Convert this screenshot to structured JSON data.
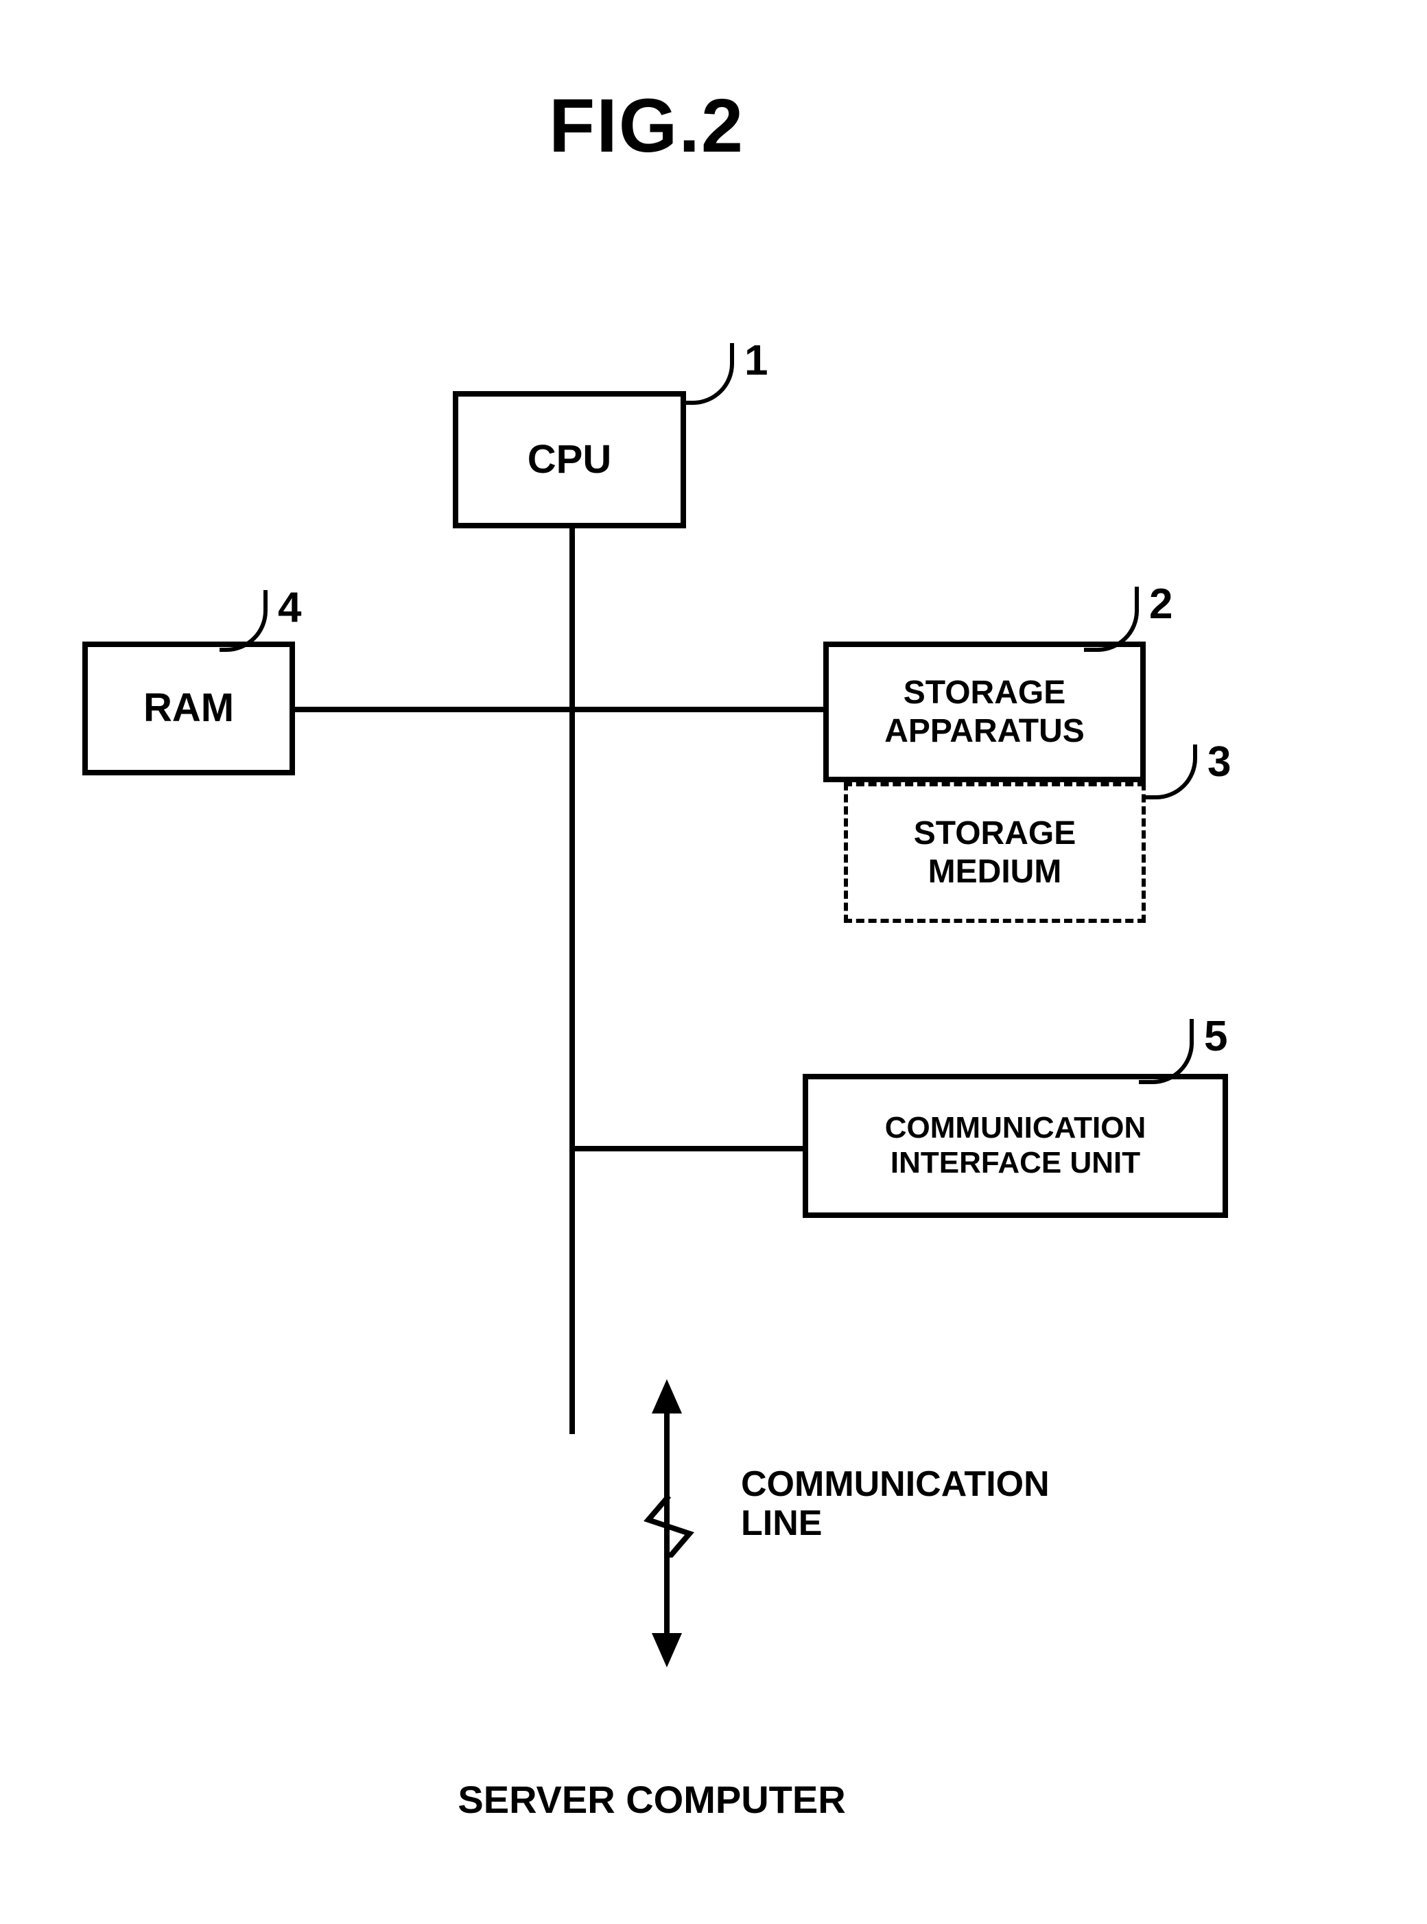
{
  "figure_title": "FIG.2",
  "blocks": {
    "cpu": {
      "label": "CPU",
      "ref": "1"
    },
    "storage": {
      "label": "STORAGE\nAPPARATUS",
      "ref": "2"
    },
    "medium": {
      "label": "STORAGE\nMEDIUM",
      "ref": "3"
    },
    "ram": {
      "label": "RAM",
      "ref": "4"
    },
    "comm": {
      "label": "COMMUNICATION\nINTERFACE UNIT",
      "ref": "5"
    }
  },
  "labels": {
    "comm_line": "COMMUNICATION\nLINE",
    "server": "SERVER COMPUTER"
  }
}
